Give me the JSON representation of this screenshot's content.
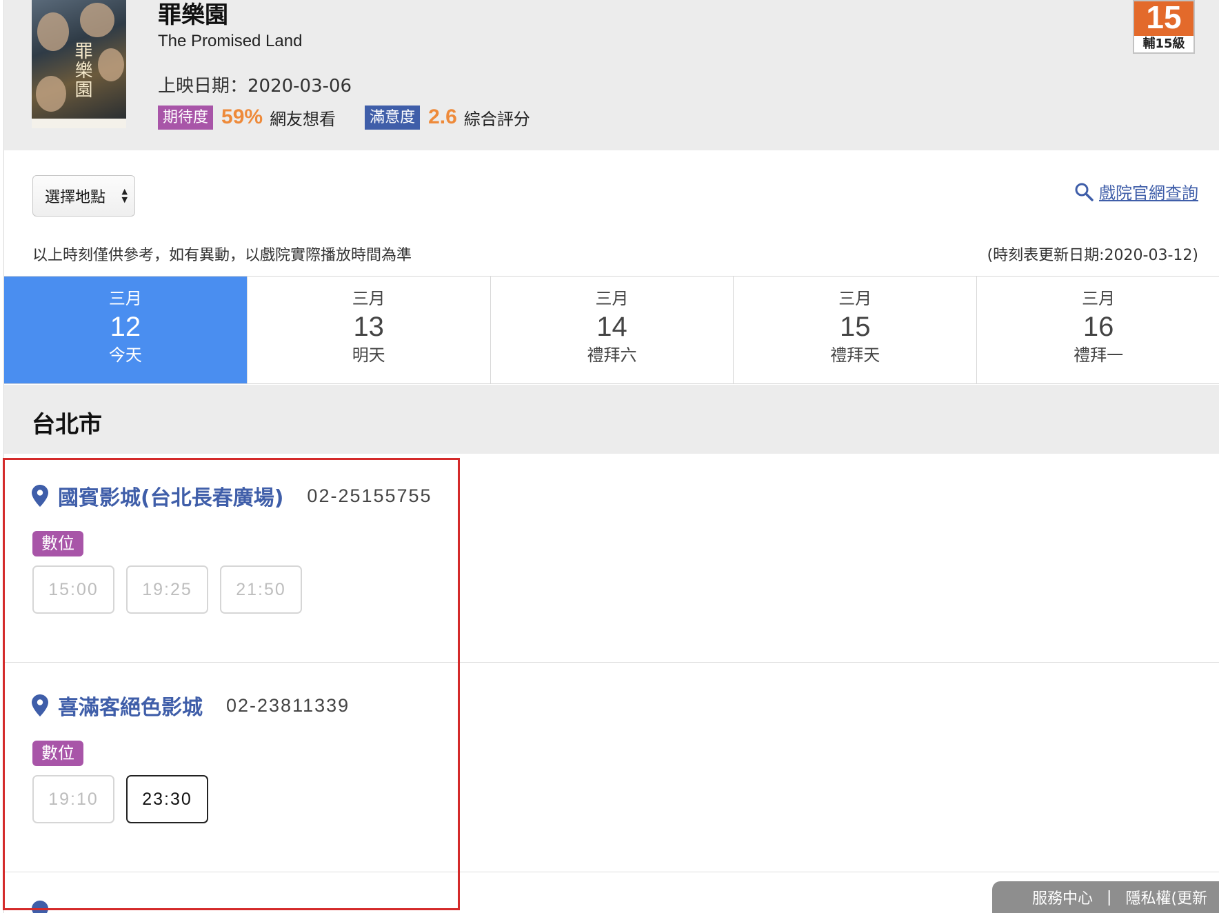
{
  "movie": {
    "title_zh": "罪樂園",
    "title_en": "The Promised Land",
    "release": "上映日期：2020-03-06",
    "expect_badge": "期待度",
    "expect_value": "59%",
    "expect_text": "網友想看",
    "satisfaction_badge": "滿意度",
    "satisfaction_value": "2.6",
    "satisfaction_text": "綜合評分",
    "age_rating_number": "15",
    "age_rating_label": "輔15級",
    "poster_title": "罪樂園"
  },
  "controls": {
    "location_select": "選擇地點",
    "official_link": "戲院官網查詢",
    "disclaimer": "以上時刻僅供參考，如有異動，以戲院實際播放時間為準",
    "update_date": "(時刻表更新日期:2020-03-12)"
  },
  "dates": [
    {
      "month": "三月",
      "day": "12",
      "weekday": "今天",
      "active": true
    },
    {
      "month": "三月",
      "day": "13",
      "weekday": "明天",
      "active": false
    },
    {
      "month": "三月",
      "day": "14",
      "weekday": "禮拜六",
      "active": false
    },
    {
      "month": "三月",
      "day": "15",
      "weekday": "禮拜天",
      "active": false
    },
    {
      "month": "三月",
      "day": "16",
      "weekday": "禮拜一",
      "active": false
    }
  ],
  "city": "台北市",
  "theaters": [
    {
      "name": "國賓影城(台北長春廣場)",
      "phone": "02-25155755",
      "format": "數位",
      "times": [
        {
          "time": "15:00",
          "available": false
        },
        {
          "time": "19:25",
          "available": false
        },
        {
          "time": "21:50",
          "available": false
        }
      ]
    },
    {
      "name": "喜滿客絕色影城",
      "phone": "02-23811339",
      "format": "數位",
      "times": [
        {
          "time": "19:10",
          "available": false
        },
        {
          "time": "23:30",
          "available": true
        }
      ]
    }
  ],
  "footer": {
    "service": "服務中心",
    "separator": "|",
    "privacy": "隱私權(更新"
  },
  "colors": {
    "brand_blue": "#3f5ea9",
    "active_date": "#4a8ef0",
    "expect_purple": "#a855a8",
    "rating_orange": "#ee8a3a",
    "highlight_red": "#d42a2a"
  }
}
